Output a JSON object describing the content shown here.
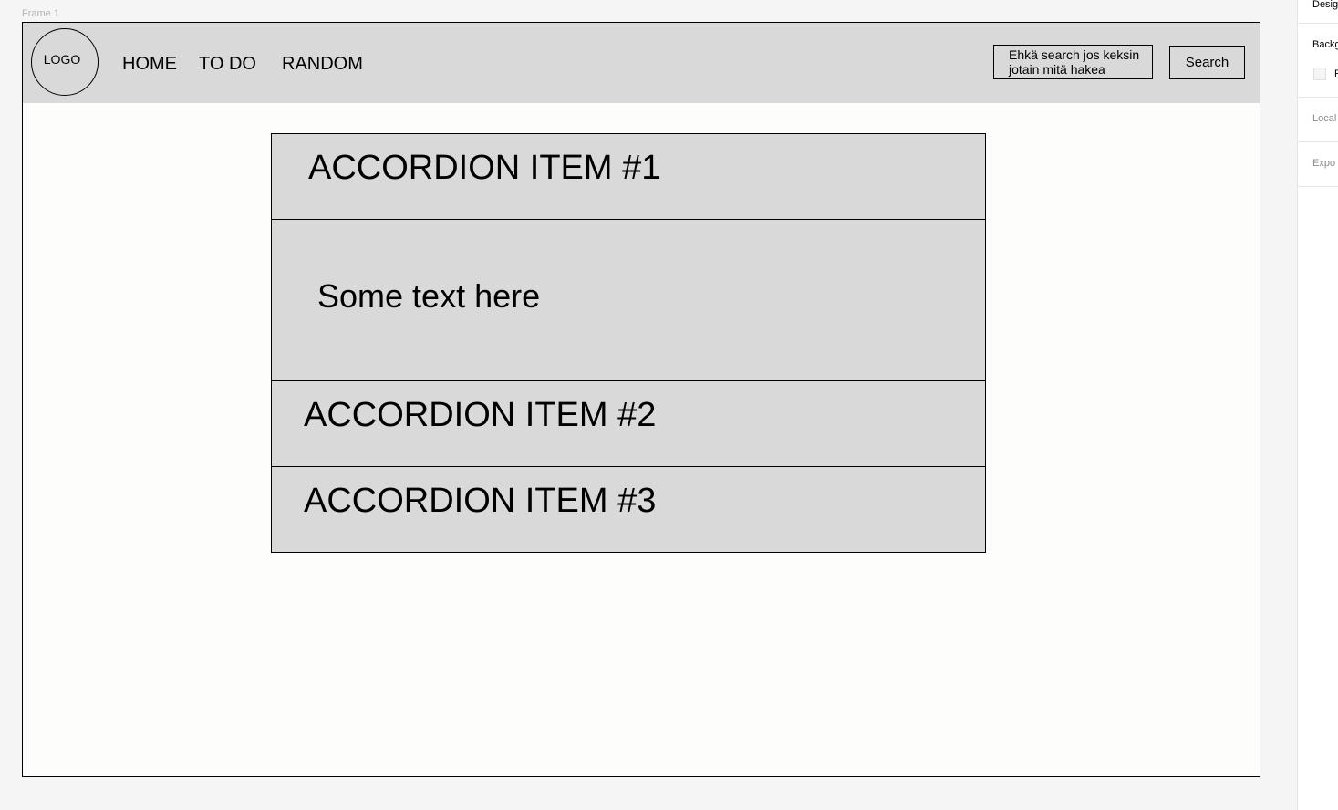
{
  "canvas": {
    "frame_label": "Frame 1"
  },
  "navbar": {
    "logo": "LOGO",
    "links": [
      "HOME",
      "TO DO",
      "RANDOM"
    ],
    "search_placeholder": "Ehkä search jos keksin jotain mitä hakea",
    "search_button": "Search"
  },
  "accordion": {
    "items": [
      {
        "title": "ACCORDION ITEM #1",
        "expanded": true,
        "body": "Some text here"
      },
      {
        "title": "ACCORDION ITEM #2",
        "expanded": false
      },
      {
        "title": "ACCORDION ITEM #3",
        "expanded": false
      }
    ]
  },
  "design_panel": {
    "tab": "Desig",
    "background_label": "Backg",
    "fill_value": "F",
    "local_label": "Local",
    "export_label": "Expo"
  },
  "colors": {
    "canvas_bg": "#f5f5f5",
    "frame_bg": "#fdfdfb",
    "navbar_bg": "#d9d9d9",
    "accordion_bg": "#d9d9d9"
  }
}
